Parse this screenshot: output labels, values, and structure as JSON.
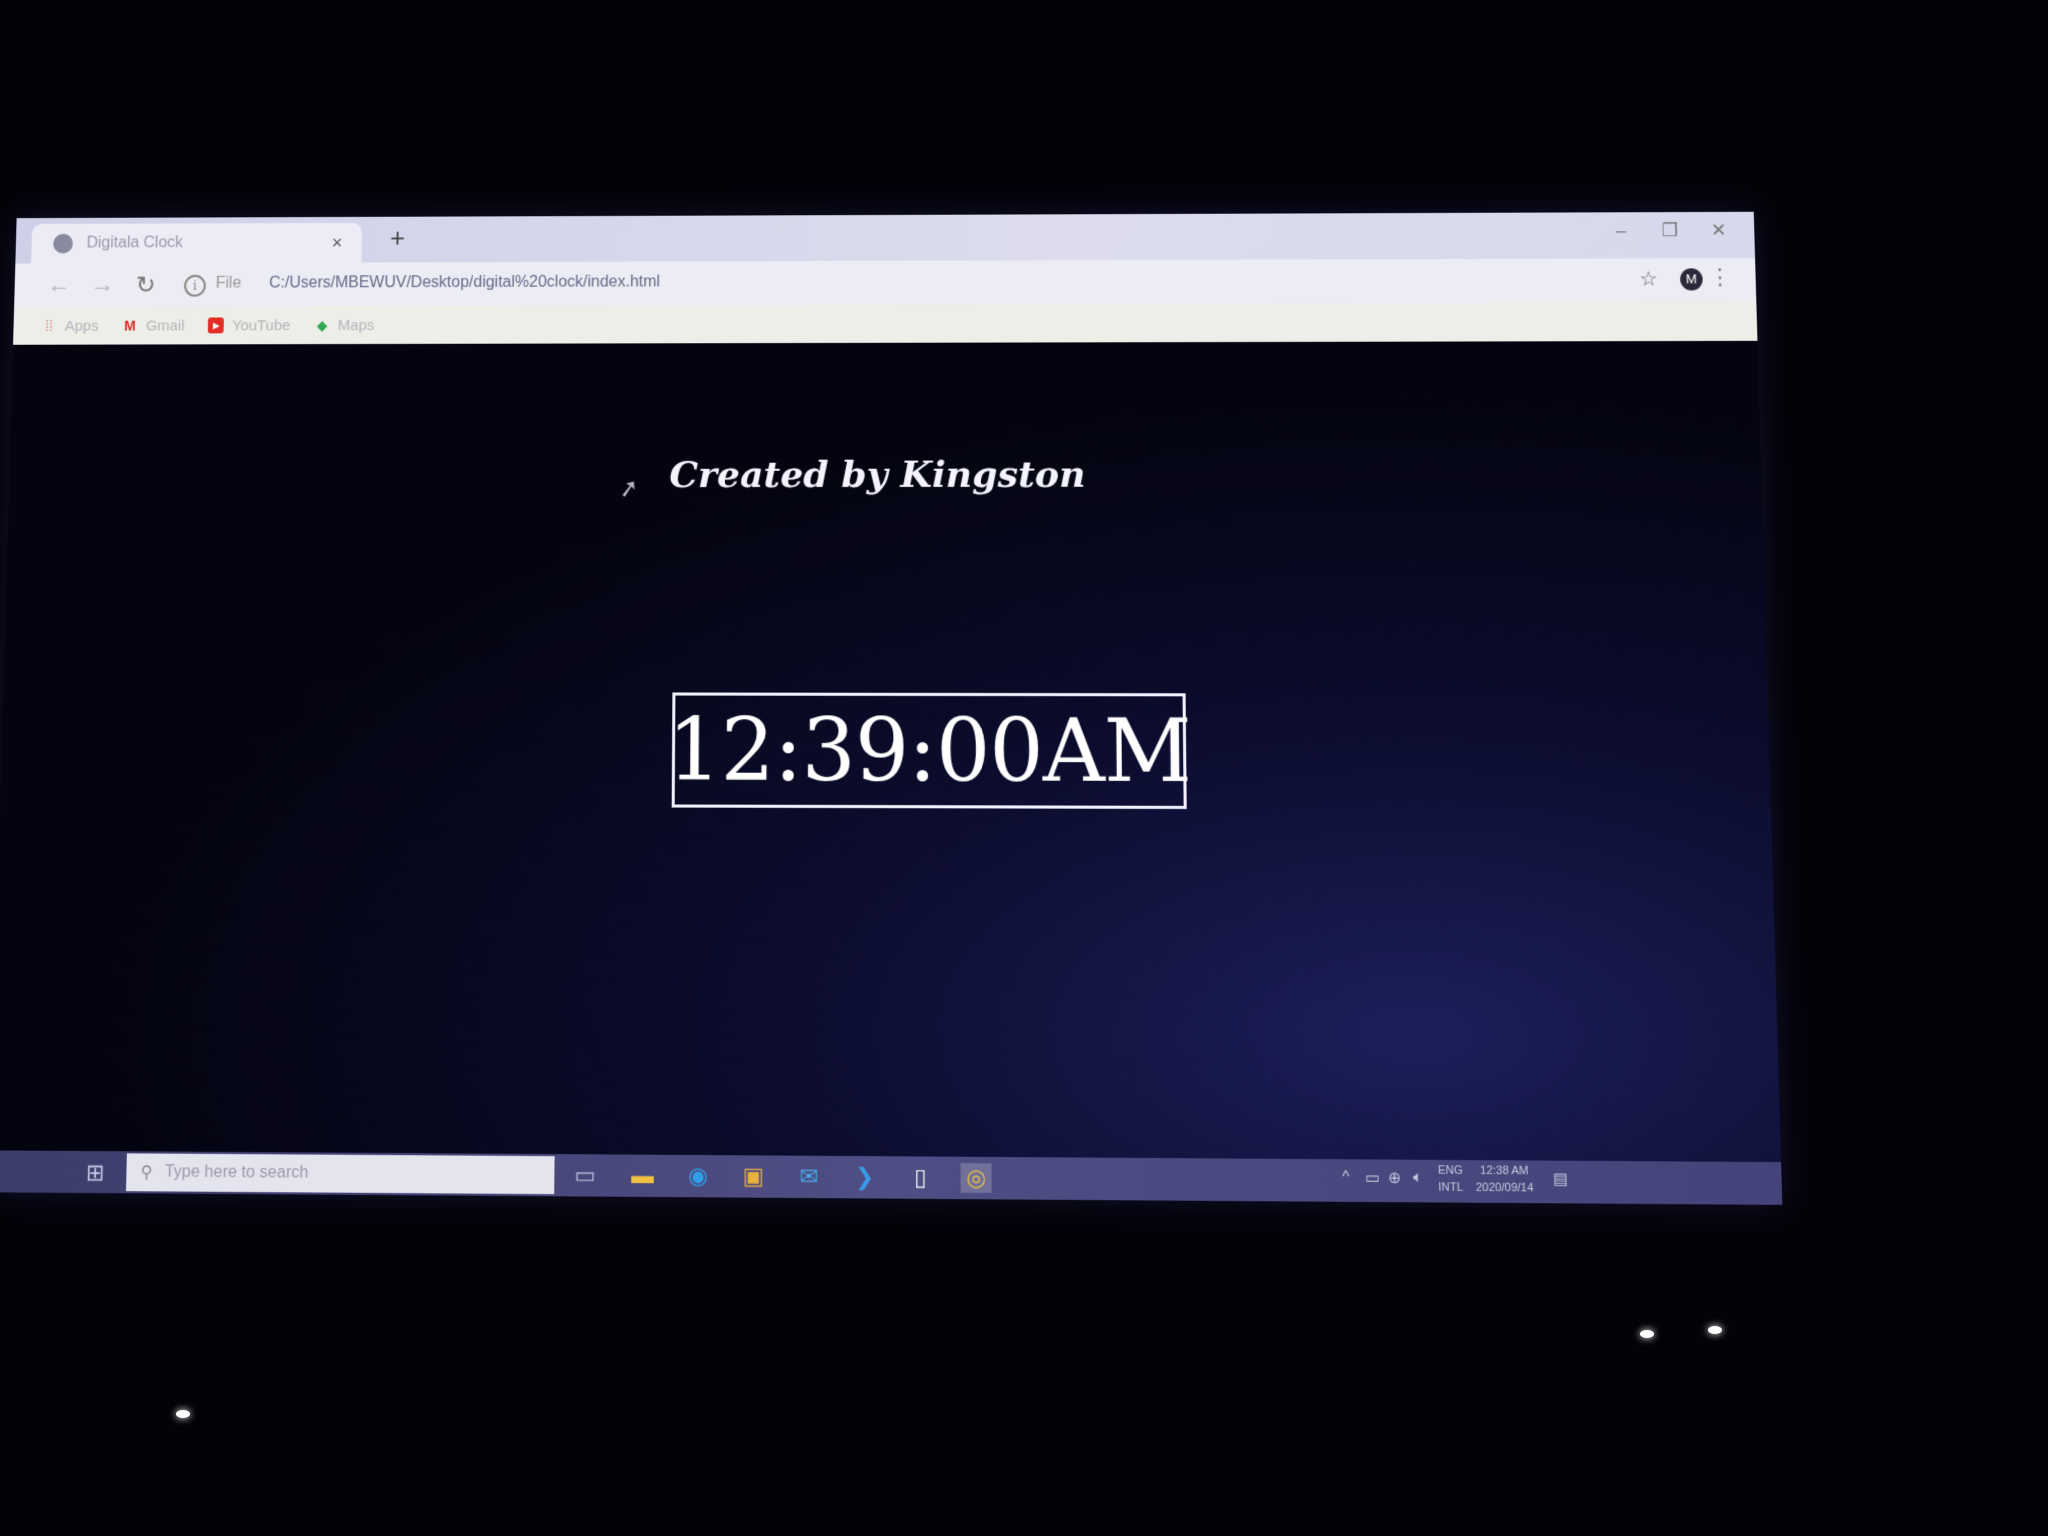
{
  "browser": {
    "tab_title": "Digitala Clock",
    "tab_close": "×",
    "new_tab": "+",
    "window_controls": {
      "minimize": "–",
      "restore": "❐",
      "close": "✕"
    },
    "nav": {
      "back": "←",
      "forward": "→",
      "reload": "↻"
    },
    "address": {
      "scheme_label": "File",
      "url": "C:/Users/MBEWUV/Desktop/digital%20clock/index.html"
    },
    "profile_initial": "M",
    "bookmarks": [
      {
        "label": "Apps",
        "icon": "apps-grid-icon",
        "color": "#c0392b"
      },
      {
        "label": "Gmail",
        "icon": "gmail-icon",
        "color": "#d93025"
      },
      {
        "label": "YouTube",
        "icon": "youtube-icon",
        "color": "#e52d27"
      },
      {
        "label": "Maps",
        "icon": "maps-icon",
        "color": "#34a853"
      }
    ]
  },
  "page": {
    "credit": "Created by Kingston",
    "clock_time": "12:39:00AM"
  },
  "taskbar": {
    "search_placeholder": "Type here to search",
    "tray": {
      "language_top": "ENG",
      "language_bottom": "INTL",
      "time": "12:38 AM",
      "date": "2020/09/14"
    }
  },
  "colors": {
    "accent_blue": "#2b5cd6",
    "clock_border": "#f0f0ff",
    "page_background": "#040410"
  }
}
